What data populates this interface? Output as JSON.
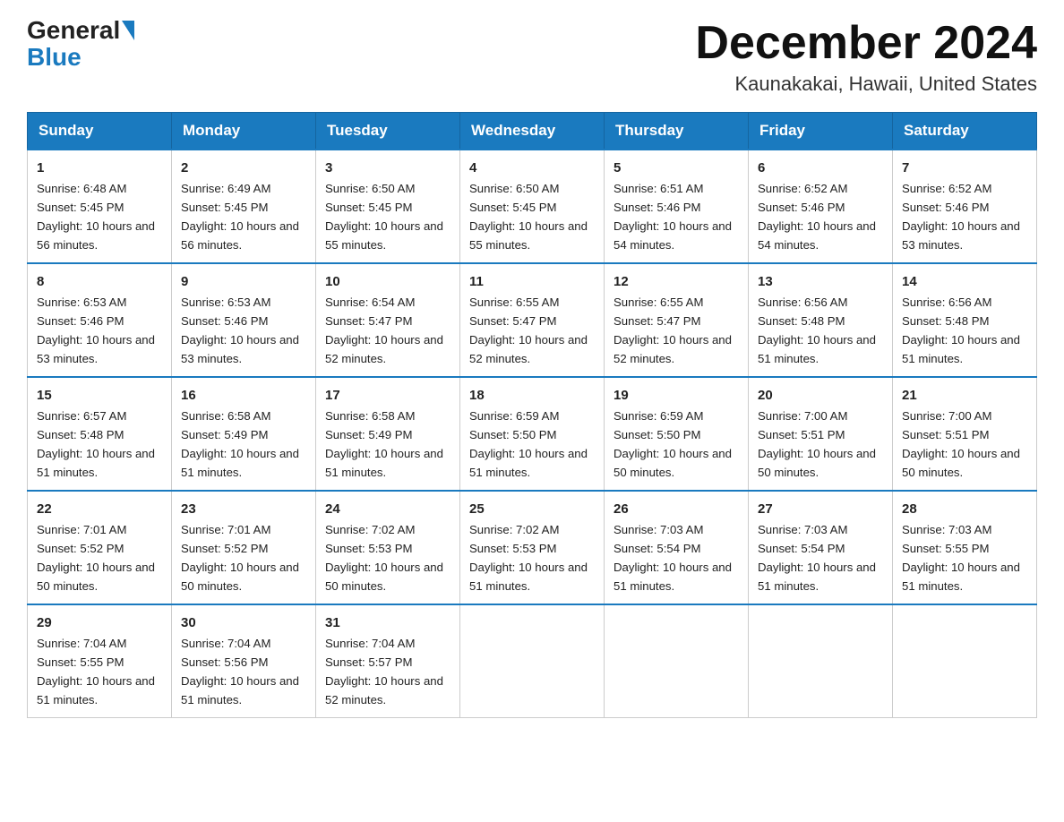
{
  "header": {
    "logo_general": "General",
    "logo_blue": "Blue",
    "month_title": "December 2024",
    "location": "Kaunakakai, Hawaii, United States"
  },
  "weekdays": [
    "Sunday",
    "Monday",
    "Tuesday",
    "Wednesday",
    "Thursday",
    "Friday",
    "Saturday"
  ],
  "weeks": [
    [
      {
        "day": "1",
        "sunrise": "6:48 AM",
        "sunset": "5:45 PM",
        "daylight": "10 hours and 56 minutes."
      },
      {
        "day": "2",
        "sunrise": "6:49 AM",
        "sunset": "5:45 PM",
        "daylight": "10 hours and 56 minutes."
      },
      {
        "day": "3",
        "sunrise": "6:50 AM",
        "sunset": "5:45 PM",
        "daylight": "10 hours and 55 minutes."
      },
      {
        "day": "4",
        "sunrise": "6:50 AM",
        "sunset": "5:45 PM",
        "daylight": "10 hours and 55 minutes."
      },
      {
        "day": "5",
        "sunrise": "6:51 AM",
        "sunset": "5:46 PM",
        "daylight": "10 hours and 54 minutes."
      },
      {
        "day": "6",
        "sunrise": "6:52 AM",
        "sunset": "5:46 PM",
        "daylight": "10 hours and 54 minutes."
      },
      {
        "day": "7",
        "sunrise": "6:52 AM",
        "sunset": "5:46 PM",
        "daylight": "10 hours and 53 minutes."
      }
    ],
    [
      {
        "day": "8",
        "sunrise": "6:53 AM",
        "sunset": "5:46 PM",
        "daylight": "10 hours and 53 minutes."
      },
      {
        "day": "9",
        "sunrise": "6:53 AM",
        "sunset": "5:46 PM",
        "daylight": "10 hours and 53 minutes."
      },
      {
        "day": "10",
        "sunrise": "6:54 AM",
        "sunset": "5:47 PM",
        "daylight": "10 hours and 52 minutes."
      },
      {
        "day": "11",
        "sunrise": "6:55 AM",
        "sunset": "5:47 PM",
        "daylight": "10 hours and 52 minutes."
      },
      {
        "day": "12",
        "sunrise": "6:55 AM",
        "sunset": "5:47 PM",
        "daylight": "10 hours and 52 minutes."
      },
      {
        "day": "13",
        "sunrise": "6:56 AM",
        "sunset": "5:48 PM",
        "daylight": "10 hours and 51 minutes."
      },
      {
        "day": "14",
        "sunrise": "6:56 AM",
        "sunset": "5:48 PM",
        "daylight": "10 hours and 51 minutes."
      }
    ],
    [
      {
        "day": "15",
        "sunrise": "6:57 AM",
        "sunset": "5:48 PM",
        "daylight": "10 hours and 51 minutes."
      },
      {
        "day": "16",
        "sunrise": "6:58 AM",
        "sunset": "5:49 PM",
        "daylight": "10 hours and 51 minutes."
      },
      {
        "day": "17",
        "sunrise": "6:58 AM",
        "sunset": "5:49 PM",
        "daylight": "10 hours and 51 minutes."
      },
      {
        "day": "18",
        "sunrise": "6:59 AM",
        "sunset": "5:50 PM",
        "daylight": "10 hours and 51 minutes."
      },
      {
        "day": "19",
        "sunrise": "6:59 AM",
        "sunset": "5:50 PM",
        "daylight": "10 hours and 50 minutes."
      },
      {
        "day": "20",
        "sunrise": "7:00 AM",
        "sunset": "5:51 PM",
        "daylight": "10 hours and 50 minutes."
      },
      {
        "day": "21",
        "sunrise": "7:00 AM",
        "sunset": "5:51 PM",
        "daylight": "10 hours and 50 minutes."
      }
    ],
    [
      {
        "day": "22",
        "sunrise": "7:01 AM",
        "sunset": "5:52 PM",
        "daylight": "10 hours and 50 minutes."
      },
      {
        "day": "23",
        "sunrise": "7:01 AM",
        "sunset": "5:52 PM",
        "daylight": "10 hours and 50 minutes."
      },
      {
        "day": "24",
        "sunrise": "7:02 AM",
        "sunset": "5:53 PM",
        "daylight": "10 hours and 50 minutes."
      },
      {
        "day": "25",
        "sunrise": "7:02 AM",
        "sunset": "5:53 PM",
        "daylight": "10 hours and 51 minutes."
      },
      {
        "day": "26",
        "sunrise": "7:03 AM",
        "sunset": "5:54 PM",
        "daylight": "10 hours and 51 minutes."
      },
      {
        "day": "27",
        "sunrise": "7:03 AM",
        "sunset": "5:54 PM",
        "daylight": "10 hours and 51 minutes."
      },
      {
        "day": "28",
        "sunrise": "7:03 AM",
        "sunset": "5:55 PM",
        "daylight": "10 hours and 51 minutes."
      }
    ],
    [
      {
        "day": "29",
        "sunrise": "7:04 AM",
        "sunset": "5:55 PM",
        "daylight": "10 hours and 51 minutes."
      },
      {
        "day": "30",
        "sunrise": "7:04 AM",
        "sunset": "5:56 PM",
        "daylight": "10 hours and 51 minutes."
      },
      {
        "day": "31",
        "sunrise": "7:04 AM",
        "sunset": "5:57 PM",
        "daylight": "10 hours and 52 minutes."
      },
      null,
      null,
      null,
      null
    ]
  ]
}
